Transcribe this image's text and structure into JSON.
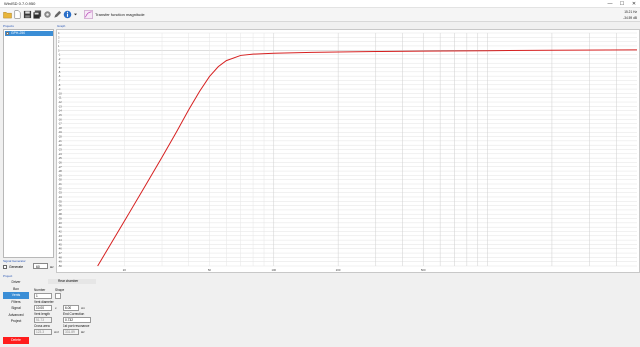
{
  "window": {
    "title": "WinISD 0.7.0.950",
    "controls": [
      "—",
      "☐",
      "✕"
    ]
  },
  "toolbar": {
    "icons": [
      "open-folder-icon",
      "new-file-icon",
      "save-icon",
      "save-all-icon",
      "settings-gear-icon",
      "pen-icon",
      "info-icon",
      "dropdown-icon",
      "graph-icon"
    ],
    "graph_type": "Transfer function magnitude",
    "readout_freq": "15.21 Hz",
    "readout_value": "-34.59 dB"
  },
  "drivers": {
    "label": "Projects",
    "items": [
      {
        "name": "GPH-250",
        "checked": true
      }
    ]
  },
  "graph": {
    "label": "Graph"
  },
  "chart_data": {
    "type": "line",
    "title": "",
    "xlabel": "",
    "ylabel": "",
    "x_scale": "log",
    "xlim": [
      10,
      5000
    ],
    "ylim": [
      -50,
      4
    ],
    "y_ticks": [
      "4",
      "3",
      "2",
      "1",
      "0",
      "-1",
      "-2",
      "-3",
      "-4",
      "-5",
      "-6",
      "-7",
      "-8",
      "-9",
      "-10",
      "-11",
      "-12",
      "-13",
      "-14",
      "-15",
      "-16",
      "-17",
      "-18",
      "-19",
      "-20",
      "-21",
      "-22",
      "-23",
      "-24",
      "-25",
      "-26",
      "-27",
      "-28",
      "-29",
      "-30",
      "-31",
      "-32",
      "-33",
      "-34",
      "-35",
      "-36",
      "-37",
      "-38",
      "-39",
      "-40",
      "-41",
      "-42",
      "-43",
      "-44",
      "-45",
      "-46",
      "-47",
      "-48",
      "-49",
      "-50"
    ],
    "x_ticks": [
      "20",
      "50",
      "100",
      "200",
      "500"
    ],
    "series": [
      {
        "color": "#d62020",
        "x": [
          15,
          20,
          25,
          30,
          35,
          40,
          45,
          50,
          55,
          60,
          70,
          80,
          100,
          150,
          200,
          300,
          500,
          1000,
          2000,
          5000
        ],
        "y": [
          -50,
          -39.6,
          -31.5,
          -24.8,
          -19.0,
          -13.8,
          -9.5,
          -6.1,
          -3.8,
          -2.4,
          -1.2,
          -0.9,
          -0.7,
          -0.5,
          -0.4,
          -0.3,
          -0.2,
          -0.1,
          0.0,
          0.1
        ]
      }
    ],
    "grid": true,
    "legend": "none"
  },
  "subwoofer": {
    "label": "Signal Generator",
    "generate_label": "Generate",
    "value": "60",
    "unit": "Hz"
  },
  "project": {
    "label": "Project",
    "nav": [
      "Driver",
      "Box",
      "Vents",
      "Filters",
      "Signal",
      "Advanced",
      "Project"
    ],
    "active": "Vents",
    "form_title": "Rear chamber",
    "number_label": "Number",
    "number_value": "1",
    "shape_label": "Shape",
    "vent_diameter_label": "Vent diameter",
    "vent_diameter_value": "10.00",
    "vent_diameter_unit": "x",
    "vent_diameter_value2": "6.00",
    "vent_diameter_unit2": "cm",
    "vent_length_label": "Vent length",
    "end_correction_label": "End Correction",
    "vent_length_value": "51.73",
    "end_correction_value": "0.732",
    "cross_area_label": "Cross area",
    "port_resonance_label": "1st port resonance",
    "cross_area_value": "123.3",
    "cross_area_unit": "cm²",
    "port_resonance_value": "331.89",
    "port_resonance_unit": "Hz"
  },
  "bottom_button": {
    "label": "Delete"
  }
}
